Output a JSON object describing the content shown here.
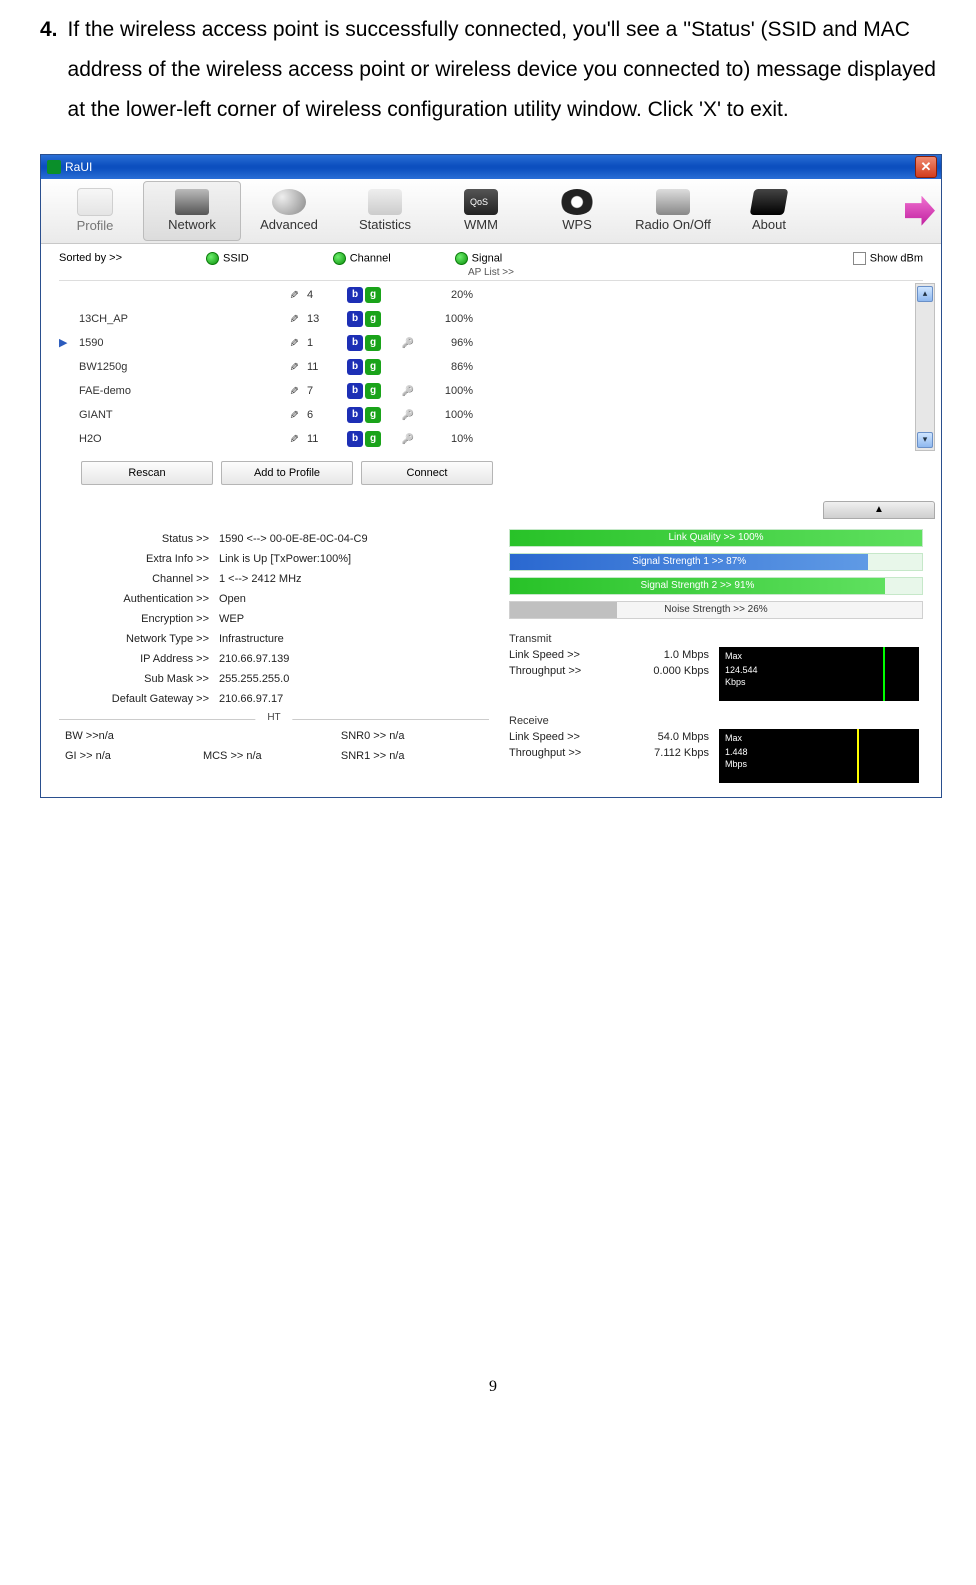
{
  "instruction": {
    "number": "4.",
    "text": "If the wireless access point is successfully connected, you'll see a ''Status' (SSID and MAC address of the wireless access point or wireless device you connected to) message displayed at the lower-left corner of wireless configuration utility window. Click 'X' to exit."
  },
  "window": {
    "title": "RaUI"
  },
  "tabs": {
    "profile": "Profile",
    "network": "Network",
    "advanced": "Advanced",
    "statistics": "Statistics",
    "wmm": "WMM",
    "wps": "WPS",
    "radio": "Radio On/Off",
    "about": "About"
  },
  "filter": {
    "sorted_by": "Sorted by >>",
    "ssid": "SSID",
    "channel": "Channel",
    "signal": "Signal",
    "show_dbm": "Show dBm",
    "ap_list": "AP List >>"
  },
  "ap_list": [
    {
      "selected": false,
      "name": "",
      "ch": "4",
      "key": false,
      "pct": "20%",
      "bar": 20
    },
    {
      "selected": false,
      "name": "13CH_AP",
      "ch": "13",
      "key": false,
      "pct": "100%",
      "bar": 100
    },
    {
      "selected": true,
      "name": "1590",
      "ch": "1",
      "key": true,
      "pct": "96%",
      "bar": 96
    },
    {
      "selected": false,
      "name": "BW1250g",
      "ch": "11",
      "key": false,
      "pct": "86%",
      "bar": 86
    },
    {
      "selected": false,
      "name": "FAE-demo",
      "ch": "7",
      "key": true,
      "pct": "100%",
      "bar": 100
    },
    {
      "selected": false,
      "name": "GIANT",
      "ch": "6",
      "key": true,
      "pct": "100%",
      "bar": 100
    },
    {
      "selected": false,
      "name": "H2O",
      "ch": "11",
      "key": true,
      "pct": "10%",
      "bar": 10
    }
  ],
  "actions": {
    "rescan": "Rescan",
    "add": "Add to Profile",
    "connect": "Connect"
  },
  "collapse": "▲",
  "status": {
    "labels": {
      "status": "Status >>",
      "extra": "Extra Info >>",
      "channel": "Channel >>",
      "auth": "Authentication >>",
      "enc": "Encryption >>",
      "ntype": "Network Type >>",
      "ip": "IP Address >>",
      "mask": "Sub Mask >>",
      "gw": "Default Gateway >>"
    },
    "values": {
      "status": "1590 <--> 00-0E-8E-0C-04-C9",
      "extra": "Link is Up [TxPower:100%]",
      "channel": "1 <--> 2412 MHz",
      "auth": "Open",
      "enc": "WEP",
      "ntype": "Infrastructure",
      "ip": "210.66.97.139",
      "mask": "255.255.255.0",
      "gw": "210.66.97.17"
    },
    "ht_title": "HT",
    "ht": {
      "bw_l": "BW >>",
      "bw_v": "n/a",
      "snr0_l": "SNR0 >>",
      "snr0_v": "n/a",
      "gi_l": "GI >>",
      "gi_v": "n/a",
      "mcs_l": "MCS >>",
      "mcs_v": "n/a",
      "snr1_l": "SNR1 >>",
      "snr1_v": "n/a"
    }
  },
  "meters": {
    "link_quality": {
      "label": "Link Quality >> 100%",
      "pct": 100
    },
    "signal1": {
      "label": "Signal Strength 1 >> 87%",
      "pct": 87
    },
    "signal2": {
      "label": "Signal Strength 2 >> 91%",
      "pct": 91
    },
    "noise": {
      "label": "Noise Strength >> 26%",
      "pct": 26
    }
  },
  "transmit": {
    "title": "Transmit",
    "link_speed_l": "Link Speed >>",
    "link_speed_v": "1.0 Mbps",
    "throughput_l": "Throughput >>",
    "throughput_v": "0.000 Kbps",
    "graph_max": "Max",
    "graph_val": "124.544",
    "graph_unit": "Kbps"
  },
  "receive": {
    "title": "Receive",
    "link_speed_l": "Link Speed >>",
    "link_speed_v": "54.0 Mbps",
    "throughput_l": "Throughput >>",
    "throughput_v": "7.112 Kbps",
    "graph_max": "Max",
    "graph_val": "1.448",
    "graph_unit": "Mbps"
  },
  "page_number": "9"
}
